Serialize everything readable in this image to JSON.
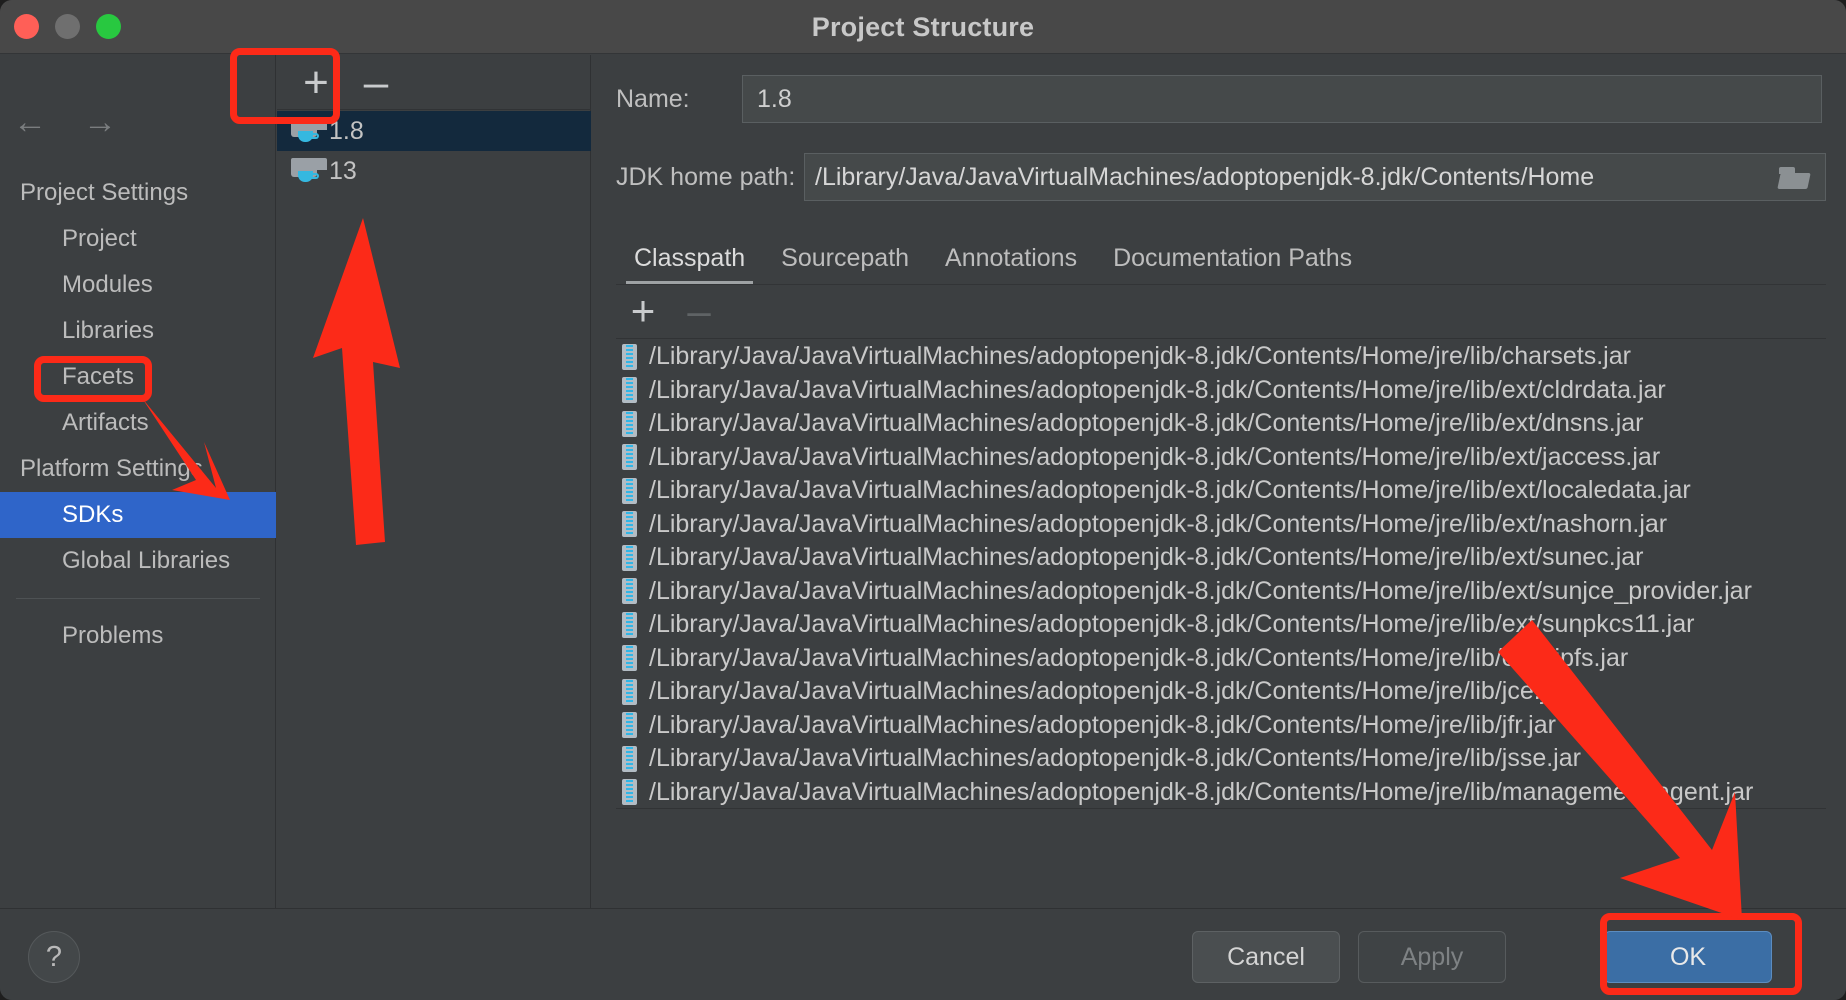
{
  "window": {
    "title": "Project Structure",
    "traffic_lights": [
      "close-red",
      "minimize-yellow",
      "maximize-green"
    ]
  },
  "nav": {
    "back": "←",
    "forward": "→"
  },
  "sidebar": {
    "groups": [
      {
        "label": "Project Settings",
        "items": [
          {
            "label": "Project",
            "selected": false
          },
          {
            "label": "Modules",
            "selected": false
          },
          {
            "label": "Libraries",
            "selected": false
          },
          {
            "label": "Facets",
            "selected": false
          },
          {
            "label": "Artifacts",
            "selected": false
          }
        ]
      },
      {
        "label": "Platform Settings",
        "items": [
          {
            "label": "SDKs",
            "selected": true
          },
          {
            "label": "Global Libraries",
            "selected": false
          }
        ]
      }
    ],
    "footer_items": [
      {
        "label": "Problems",
        "selected": false
      }
    ]
  },
  "sdk_panel": {
    "toolbar": {
      "add_label": "+",
      "remove_label": "–"
    },
    "items": [
      {
        "label": "1.8",
        "icon": "jdk-folder-icon",
        "selected": true
      },
      {
        "label": "13",
        "icon": "jdk-folder-icon",
        "selected": false
      }
    ]
  },
  "detail": {
    "name": {
      "label": "Name:",
      "value": "1.8"
    },
    "jdk_home_path": {
      "label": "JDK home path:",
      "value": "/Library/Java/JavaVirtualMachines/adoptopenjdk-8.jdk/Contents/Home",
      "browse_icon": "folder-browse-icon"
    },
    "tabs": [
      {
        "label": "Classpath",
        "active": true
      },
      {
        "label": "Sourcepath",
        "active": false
      },
      {
        "label": "Annotations",
        "active": false
      },
      {
        "label": "Documentation Paths",
        "active": false
      }
    ],
    "classpath_toolbar": {
      "add_label": "+",
      "remove_label": "–",
      "remove_disabled": true
    },
    "classpath_entries": [
      "/Library/Java/JavaVirtualMachines/adoptopenjdk-8.jdk/Contents/Home/jre/lib/charsets.jar",
      "/Library/Java/JavaVirtualMachines/adoptopenjdk-8.jdk/Contents/Home/jre/lib/ext/cldrdata.jar",
      "/Library/Java/JavaVirtualMachines/adoptopenjdk-8.jdk/Contents/Home/jre/lib/ext/dnsns.jar",
      "/Library/Java/JavaVirtualMachines/adoptopenjdk-8.jdk/Contents/Home/jre/lib/ext/jaccess.jar",
      "/Library/Java/JavaVirtualMachines/adoptopenjdk-8.jdk/Contents/Home/jre/lib/ext/localedata.jar",
      "/Library/Java/JavaVirtualMachines/adoptopenjdk-8.jdk/Contents/Home/jre/lib/ext/nashorn.jar",
      "/Library/Java/JavaVirtualMachines/adoptopenjdk-8.jdk/Contents/Home/jre/lib/ext/sunec.jar",
      "/Library/Java/JavaVirtualMachines/adoptopenjdk-8.jdk/Contents/Home/jre/lib/ext/sunjce_provider.jar",
      "/Library/Java/JavaVirtualMachines/adoptopenjdk-8.jdk/Contents/Home/jre/lib/ext/sunpkcs11.jar",
      "/Library/Java/JavaVirtualMachines/adoptopenjdk-8.jdk/Contents/Home/jre/lib/ext/zipfs.jar",
      "/Library/Java/JavaVirtualMachines/adoptopenjdk-8.jdk/Contents/Home/jre/lib/jce.jar",
      "/Library/Java/JavaVirtualMachines/adoptopenjdk-8.jdk/Contents/Home/jre/lib/jfr.jar",
      "/Library/Java/JavaVirtualMachines/adoptopenjdk-8.jdk/Contents/Home/jre/lib/jsse.jar",
      "/Library/Java/JavaVirtualMachines/adoptopenjdk-8.jdk/Contents/Home/jre/lib/management-agent.jar"
    ]
  },
  "footer": {
    "help_label": "?",
    "cancel_label": "Cancel",
    "apply_label": "Apply",
    "apply_disabled": true,
    "ok_label": "OK"
  },
  "annotations": {
    "color": "#fc2a18",
    "highlight_boxes": [
      "sdk-toolbar-add-remove",
      "sidebar-item-sdks",
      "ok-button"
    ],
    "arrows": [
      "arrow-to-sdk-toolbar",
      "arrow-to-sdks-item",
      "arrow-to-ok-button"
    ]
  },
  "colors": {
    "background": "#3c3f41",
    "titlebar": "#484848",
    "selection_blue": "#2f65c9",
    "row_selected": "#13293d",
    "ok_button": "#3b6ea5",
    "annotation_red": "#fc2a18",
    "jar_icon_accent": "#2fb6e8"
  }
}
